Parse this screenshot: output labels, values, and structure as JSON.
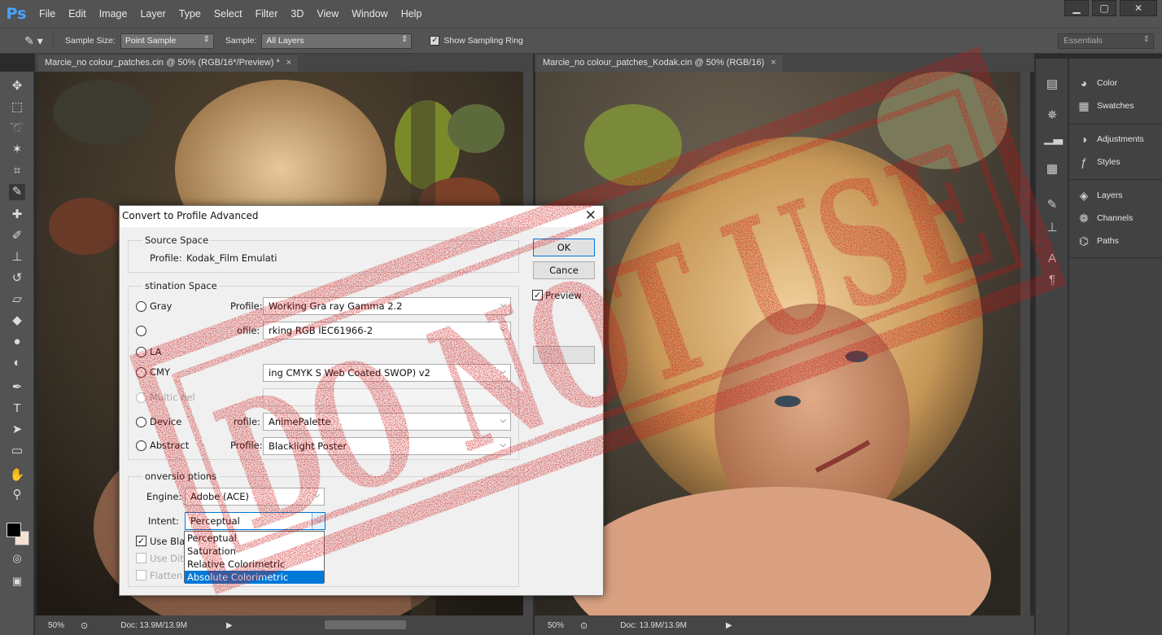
{
  "app": {
    "logo": "Ps",
    "menu": [
      "File",
      "Edit",
      "Image",
      "Layer",
      "Type",
      "Select",
      "Filter",
      "3D",
      "View",
      "Window",
      "Help"
    ],
    "window_controls": [
      "minimize-icon",
      "maximize-icon",
      "close-icon"
    ]
  },
  "options_bar": {
    "tool_icon": "eyedropper-icon",
    "sample_size_label": "Sample Size:",
    "sample_size_value": "Point Sample",
    "sample_label": "Sample:",
    "sample_value": "All Layers",
    "show_ring_label": "Show Sampling Ring",
    "show_ring_checked": true,
    "workspace": "Essentials"
  },
  "documents": [
    {
      "tab_title": "Marcie_no colour_patches.cin @ 50% (RGB/16*/Preview) *",
      "zoom": "50%",
      "doc_info": "Doc: 13.9M/13.9M"
    },
    {
      "tab_title": "Marcie_no colour_patches_Kodak.cin @ 50% (RGB/16)",
      "zoom": "50%",
      "doc_info": "Doc: 13.9M/13.9M"
    }
  ],
  "tools": [
    "move-icon",
    "marquee-icon",
    "lasso-icon",
    "magic-wand-icon",
    "crop-icon",
    "eyedropper-icon",
    "healing-brush-icon",
    "brush-icon",
    "clone-stamp-icon",
    "history-brush-icon",
    "eraser-icon",
    "paint-bucket-icon",
    "blur-icon",
    "dodge-icon",
    "pen-icon",
    "type-icon",
    "path-selection-icon",
    "rectangle-icon",
    "hand-icon",
    "zoom-icon"
  ],
  "panels": {
    "groups": [
      [
        {
          "label": "Color",
          "icon": "color-icon"
        },
        {
          "label": "Swatches",
          "icon": "swatches-icon"
        }
      ],
      [
        {
          "label": "Adjustments",
          "icon": "adjustments-icon"
        },
        {
          "label": "Styles",
          "icon": "styles-icon"
        }
      ],
      [
        {
          "label": "Layers",
          "icon": "layers-icon"
        },
        {
          "label": "Channels",
          "icon": "channels-icon"
        },
        {
          "label": "Paths",
          "icon": "paths-icon"
        }
      ]
    ]
  },
  "dialog": {
    "title": "Convert to Profile Advanced",
    "source_space": {
      "label": "Source Space",
      "profile_label": "Profile:",
      "profile_value": "Kodak_Film Emulati"
    },
    "destination_space": {
      "label": "stination Space",
      "rows": [
        {
          "radio_label": "Gray",
          "profile_label": "Profile:",
          "profile_value": "Working Gra  ray Gamma 2.2",
          "enabled": true
        },
        {
          "radio_label": "",
          "profile_label": "ofile:",
          "profile_value": "rking RGB     IEC61966-2",
          "enabled": true
        },
        {
          "radio_label": "LA",
          "profile_label": "",
          "profile_value": "",
          "enabled": true
        },
        {
          "radio_label": "CMY",
          "profile_label": "",
          "profile_value": "ing CMYK    S Web Coated  SWOP) v2",
          "enabled": true
        },
        {
          "radio_label": "Multic  nel",
          "profile_label": "",
          "profile_value": "",
          "enabled": false
        },
        {
          "radio_label": "Device",
          "profile_label": "rofile:",
          "profile_value": "AnimePalette",
          "enabled": true
        },
        {
          "radio_label": "Abstract",
          "profile_label": "Profile:",
          "profile_value": "Blacklight Poster",
          "enabled": true
        }
      ]
    },
    "conversion_options": {
      "label": "onversio   ptions",
      "engine_label": "Engine:",
      "engine_value": "Adobe (ACE)",
      "intent_label": "Intent:",
      "intent_value": "Perceptual",
      "intent_options": [
        "Perceptual",
        "Saturation",
        "Relative Colorimetric",
        "Absolute Colorimetric"
      ],
      "intent_highlighted": "Absolute Colorimetric",
      "use_black_label": "Use Blac",
      "use_dither_label": "Use Dith",
      "flatten_label": "Flatten"
    },
    "buttons": {
      "ok": "OK",
      "cancel": "Cance",
      "preview_label": "Preview"
    }
  },
  "stamp": {
    "text": "DO NOT USE",
    "color": "#cc1414"
  }
}
